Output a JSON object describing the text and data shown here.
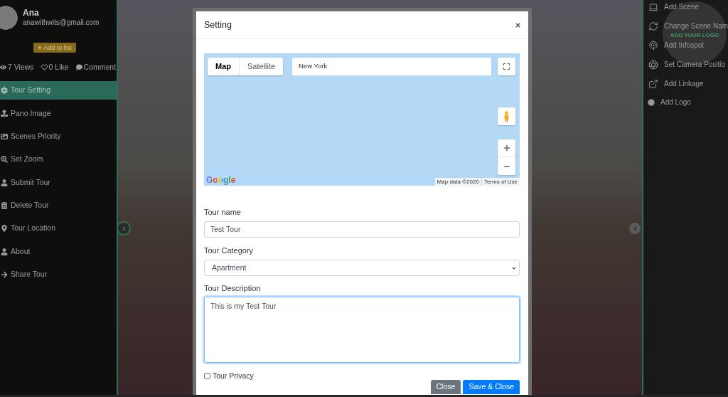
{
  "sidebar": {
    "profile": {
      "name": "Ana",
      "email": "anawithwits@gmail.com"
    },
    "add_button": "Add to list",
    "stats": [
      "7 Views",
      "0 Like",
      "Comment"
    ],
    "menu": [
      {
        "label": "Tour Setting",
        "selected": true
      },
      {
        "label": "Pano Image",
        "selected": false
      },
      {
        "label": "Scenes Priority",
        "selected": false
      },
      {
        "label": "Set Zoom",
        "selected": false
      },
      {
        "label": "Submit Tour",
        "selected": false
      },
      {
        "label": "Delete Tour",
        "selected": false
      },
      {
        "label": "Tour Location",
        "selected": false
      },
      {
        "label": "About",
        "selected": false
      },
      {
        "label": "Share Tour",
        "selected": false
      }
    ]
  },
  "tools_panel": {
    "items": [
      "Add Scene",
      "Change Scene Nam",
      "Add Infospot",
      "Set Camera Positio",
      "Add Linkage",
      "Add Logo"
    ],
    "logo_placeholder": "ADD YOUR LOGO"
  },
  "dialog": {
    "title": "Setting",
    "map": {
      "map_types": [
        {
          "label": "Map",
          "selected": true
        },
        {
          "label": "Satellite",
          "selected": false
        }
      ],
      "search": {
        "value": "New York"
      },
      "logo": "Google",
      "attribution": "Map data ©2020",
      "terms": "Terms of Use"
    },
    "form": {
      "fields": [
        {
          "kind": "text",
          "label": "Tour name",
          "value": "Test Tour",
          "focused": false
        },
        {
          "kind": "select",
          "label": "Tour Category",
          "value": "Apartment",
          "focused": false
        },
        {
          "kind": "textarea",
          "label": "Tour Description",
          "value": "This is my Test Tour",
          "focused": true
        }
      ],
      "privacy": {
        "label": "Tour Privacy",
        "checked": false
      },
      "buttons": [
        {
          "label": "Close",
          "kind": "secondary"
        },
        {
          "label": "Save & Close",
          "kind": "primary"
        }
      ]
    }
  }
}
